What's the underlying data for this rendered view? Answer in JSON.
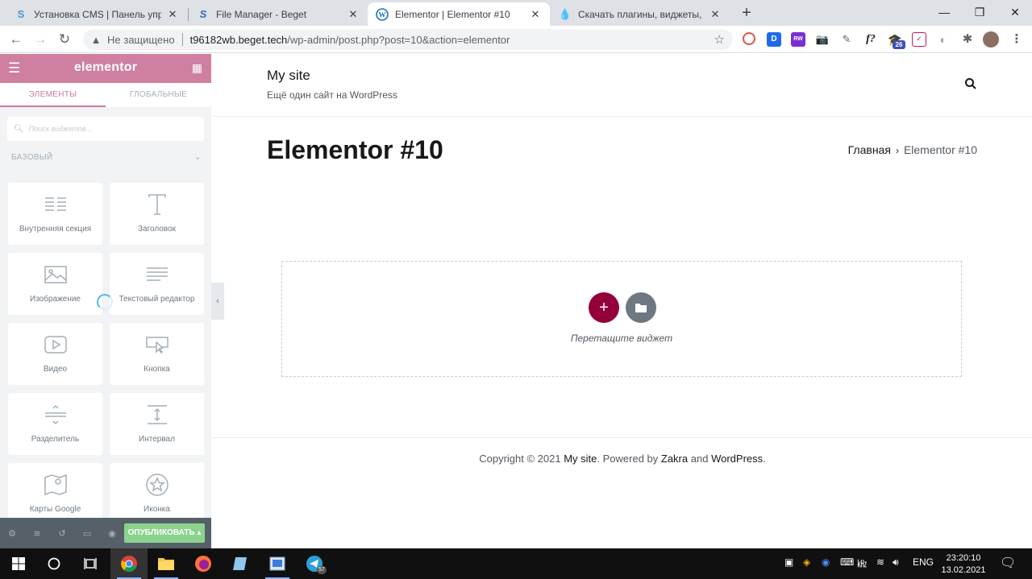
{
  "browser": {
    "tabs": [
      {
        "title": "Установка CMS | Панель управ",
        "icon": "beget-icon"
      },
      {
        "title": "File Manager - Beget",
        "icon": "beget-s-icon"
      },
      {
        "title": "Elementor | Elementor #10",
        "icon": "wordpress-icon"
      },
      {
        "title": "Скачать плагины, виджеты, мод",
        "icon": "droplet-icon"
      }
    ],
    "address": {
      "security": "Не защищено",
      "host": "t96182wb.beget.tech",
      "path": "/wp-admin/post.php?post=10&action=elementor"
    },
    "extension_badge": "26"
  },
  "panel": {
    "logo": "elementor",
    "tabs": [
      "ЭЛЕМЕНТЫ",
      "ГЛОБАЛЬНЫЕ"
    ],
    "search_placeholder": "Поиск виджетов...",
    "category": "БАЗОВЫЙ",
    "widgets": [
      {
        "label": "Внутренняя секция",
        "icon": "inner-section-icon"
      },
      {
        "label": "Заголовок",
        "icon": "heading-icon"
      },
      {
        "label": "Изображение",
        "icon": "image-icon"
      },
      {
        "label": "Текстовый редактор",
        "icon": "text-editor-icon"
      },
      {
        "label": "Видео",
        "icon": "video-icon"
      },
      {
        "label": "Кнопка",
        "icon": "button-icon"
      },
      {
        "label": "Разделитель",
        "icon": "divider-icon"
      },
      {
        "label": "Интервал",
        "icon": "spacer-icon"
      },
      {
        "label": "Карты Google",
        "icon": "google-maps-icon"
      },
      {
        "label": "Иконка",
        "icon": "star-icon"
      }
    ],
    "publish": "ОПУБЛИКОВАТЬ"
  },
  "preview": {
    "site_title": "My site",
    "tagline": "Ещё один сайт на WordPress",
    "page_title": "Elementor #10",
    "breadcrumb": {
      "home": "Главная",
      "current": "Elementor #10"
    },
    "drop_text": "Перетащите виджет",
    "footer": {
      "copyright": "Copyright © 2021",
      "site": "My site",
      "powered": ". Powered by",
      "theme": "Zakra",
      "and": "and",
      "cms": "WordPress",
      "end": "."
    }
  },
  "taskbar": {
    "lang": "ENG",
    "time": "23:20:10",
    "date": "13.02.2021",
    "telegram_badge": "57"
  },
  "colors": {
    "elementor_pink": "#cf7f9f",
    "add_button": "#93003c",
    "publish_green": "#8cd28f"
  }
}
